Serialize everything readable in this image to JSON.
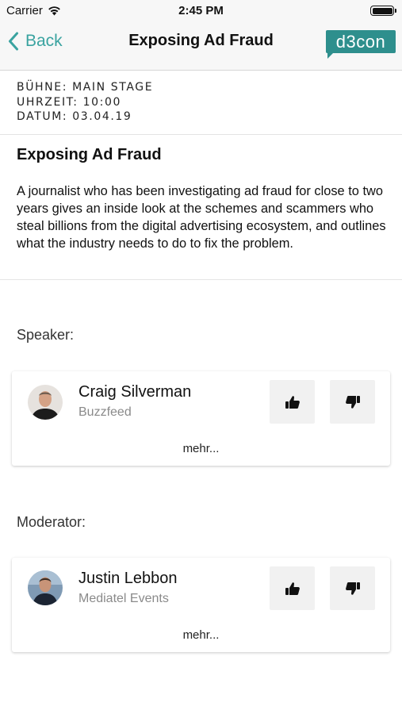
{
  "status_bar": {
    "carrier": "Carrier",
    "time": "2:45 PM"
  },
  "nav": {
    "back_label": "Back",
    "title": "Exposing Ad Fraud",
    "logo_text": "d3con",
    "accent_color": "#3aa3a0",
    "logo_color": "#2e8f8d"
  },
  "meta": {
    "stage": "BÜHNE: MAIN STAGE",
    "time": "UHRZEIT: 10:00",
    "date": "DATUM: 03.04.19"
  },
  "talk": {
    "title": "Exposing Ad Fraud",
    "description": "A journalist who has been investigating ad fraud for close to two years gives an inside look at the schemes and scammers who steal billions from the digital advertising ecosystem, and outlines what the industry needs to do to fix the problem."
  },
  "speaker_section": {
    "label": "Speaker:",
    "person": {
      "name": "Craig Silverman",
      "org": "Buzzfeed",
      "more_label": "mehr...",
      "like_icon": "thumbs-up-icon",
      "dislike_icon": "thumbs-down-icon"
    }
  },
  "moderator_section": {
    "label": "Moderator:",
    "person": {
      "name": "Justin Lebbon",
      "org": "Mediatel Events",
      "more_label": "mehr...",
      "like_icon": "thumbs-up-icon",
      "dislike_icon": "thumbs-down-icon"
    }
  }
}
